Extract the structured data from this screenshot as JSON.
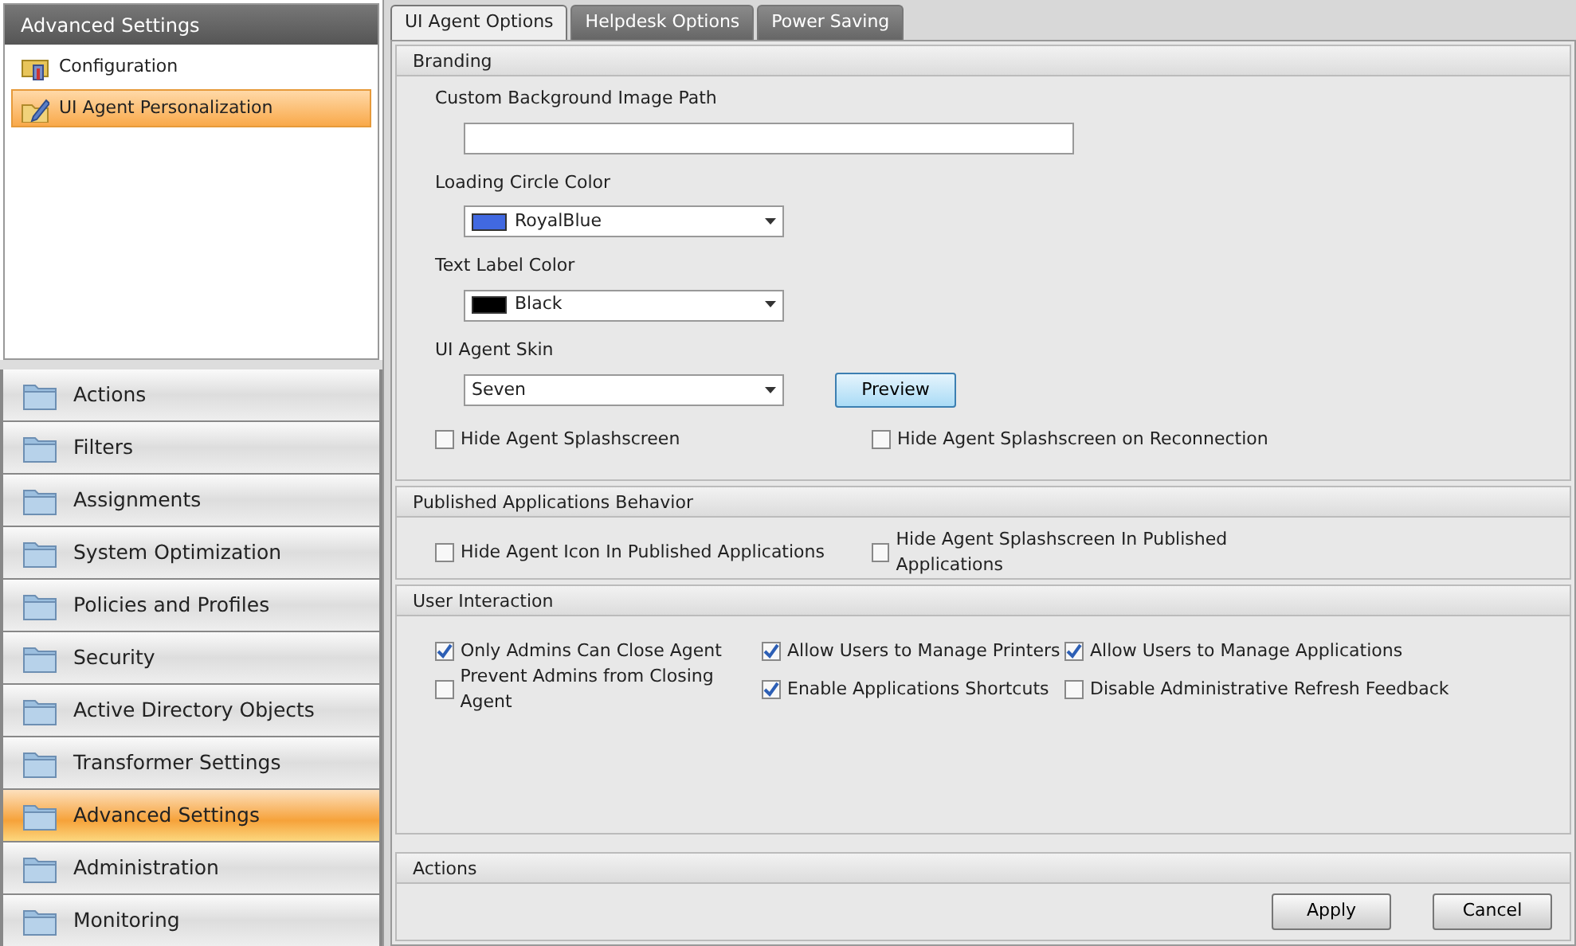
{
  "sidebar": {
    "title": "Advanced Settings",
    "items": [
      {
        "label": "Configuration",
        "kind": "config",
        "selected": false
      },
      {
        "label": "UI Agent Personalization",
        "kind": "edit",
        "selected": true
      }
    ],
    "nav": [
      {
        "label": "Actions",
        "selected": false
      },
      {
        "label": "Filters",
        "selected": false
      },
      {
        "label": "Assignments",
        "selected": false
      },
      {
        "label": "System Optimization",
        "selected": false
      },
      {
        "label": "Policies and Profiles",
        "selected": false
      },
      {
        "label": "Security",
        "selected": false
      },
      {
        "label": "Active Directory Objects",
        "selected": false
      },
      {
        "label": "Transformer Settings",
        "selected": false
      },
      {
        "label": "Advanced Settings",
        "selected": true
      },
      {
        "label": "Administration",
        "selected": false
      },
      {
        "label": "Monitoring",
        "selected": false
      }
    ]
  },
  "tabs": [
    {
      "label": "UI Agent Options",
      "selected": true
    },
    {
      "label": "Helpdesk Options",
      "selected": false
    },
    {
      "label": "Power Saving",
      "selected": false
    }
  ],
  "sections": [
    {
      "title": "Branding",
      "kind": "form",
      "fields": [
        {
          "kind": "text",
          "label": "Custom Background Image Path"
        },
        {
          "kind": "color",
          "label": "Loading Circle Color",
          "value": "RoyalBlue",
          "color": "#4169e1"
        },
        {
          "kind": "color",
          "label": "Text Label Color",
          "value": "Black",
          "color": "#000000"
        },
        {
          "kind": "select",
          "label": "UI Agent Skin",
          "value": "Seven",
          "button": "Preview"
        }
      ],
      "rows": [
        [
          {
            "label": "Hide Agent Splashscreen",
            "checked": false
          },
          {
            "label": "Hide Agent Splashscreen on Reconnection",
            "checked": false
          }
        ]
      ]
    },
    {
      "title": "Published Applications Behavior",
      "kind": "checks",
      "rows": [
        [
          {
            "label": "Hide Agent Icon In Published Applications",
            "checked": false
          },
          {
            "label": "Hide Agent Splashscreen In Published Applications",
            "checked": false
          }
        ]
      ]
    },
    {
      "title": "User Interaction",
      "kind": "checks3",
      "rows": [
        [
          {
            "label": "Only Admins Can Close Agent",
            "checked": true
          },
          {
            "label": "Allow Users to Manage Printers",
            "checked": true
          },
          {
            "label": "Allow Users to Manage Applications",
            "checked": true
          }
        ],
        [
          {
            "label": "Prevent Admins from Closing Agent",
            "checked": false
          },
          {
            "label": "Enable Applications Shortcuts",
            "checked": true
          },
          {
            "label": "Disable Administrative Refresh Feedback",
            "checked": false
          }
        ]
      ]
    }
  ],
  "actions": {
    "title": "Actions",
    "buttons": [
      "Apply",
      "Cancel"
    ]
  }
}
